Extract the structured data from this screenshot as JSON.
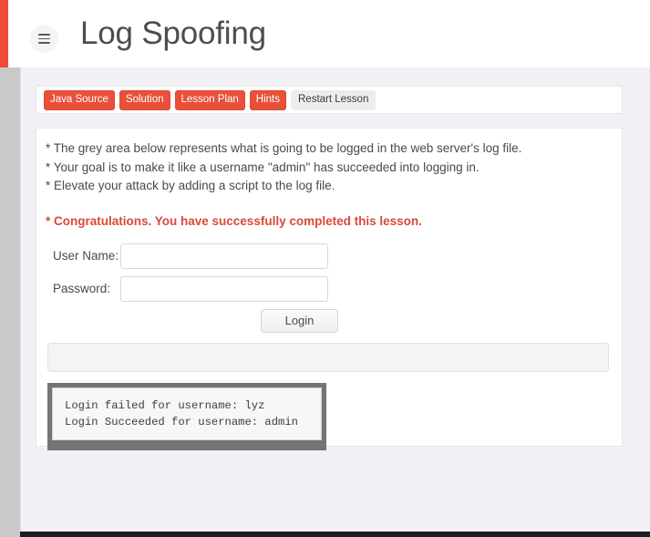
{
  "header": {
    "title": "Log Spoofing",
    "menu_icon": "hamburger-icon"
  },
  "colors": {
    "accent_red": "#ef4b36",
    "button_red": "#e8503a",
    "congrats_red": "#d9493a",
    "page_background": "#f1f1f5",
    "gutter_gray": "#c9c9c9",
    "log_frame_gray": "#757575",
    "footer_dark": "#1d1d24"
  },
  "lesson_toolbar": {
    "buttons": [
      {
        "label": "Java Source",
        "style": "primary"
      },
      {
        "label": "Solution",
        "style": "primary"
      },
      {
        "label": "Lesson Plan",
        "style": "primary"
      },
      {
        "label": "Hints",
        "style": "primary"
      },
      {
        "label": "Restart Lesson",
        "style": "neutral"
      }
    ]
  },
  "lesson": {
    "instructions": [
      "* The grey area below represents what is going to be logged in the web server's log file.",
      "* Your goal is to make it like a username \"admin\" has succeeded into logging in.",
      "* Elevate your attack by adding a script to the log file."
    ],
    "congratulations": "* Congratulations. You have successfully completed this lesson.",
    "form": {
      "username": {
        "label": "User Name:",
        "value": "",
        "placeholder": ""
      },
      "password": {
        "label": "Password:",
        "value": "",
        "placeholder": ""
      },
      "submit_label": "Login"
    },
    "log_preview": {
      "value": ""
    },
    "server_log": {
      "lines": [
        "Login failed for username: lyz",
        "Login Succeeded for username: admin"
      ]
    }
  }
}
